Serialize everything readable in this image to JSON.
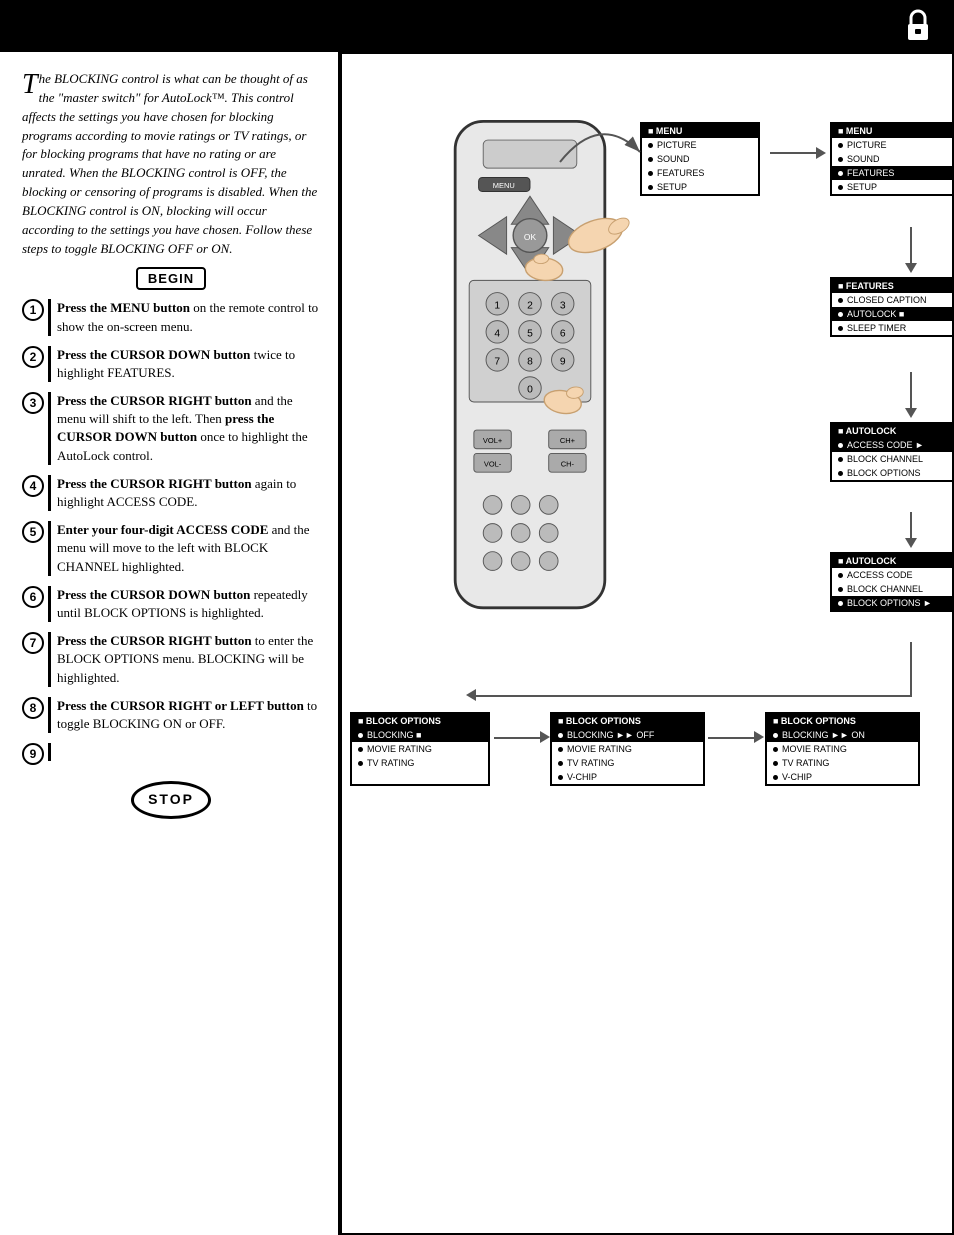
{
  "topBar": {
    "background": "#000"
  },
  "lockIcon": "🔒",
  "intro": {
    "dropCap": "T",
    "text": "he BLOCKING control is what can be thought of as the \"master switch\" for AutoLock™. This control affects the settings you have chosen for blocking programs according to movie ratings or TV ratings, or for blocking programs that have no rating or are unrated. When the BLOCKING control is OFF, the blocking or censoring of programs is disabled. When the BLOCKING control is ON, blocking will occur according to the settings you have chosen. Follow these steps to toggle BLOCKING OFF or ON."
  },
  "begin": "BEGIN",
  "steps": [
    {
      "num": "1",
      "text": "Press the MENU button on the remote control to show the on-screen menu."
    },
    {
      "num": "2",
      "text": "Press the CURSOR DOWN button twice to highlight FEATURES."
    },
    {
      "num": "3",
      "text": "Press the CURSOR RIGHT button and the menu will shift to the left. Then press the CURSOR DOWN button once to highlight the AutoLock control."
    },
    {
      "num": "4",
      "text": "Press the CURSOR RIGHT button again to highlight ACCESS CODE."
    },
    {
      "num": "5",
      "text": "Enter your four-digit ACCESS CODE and the menu will move to the left with BLOCK CHANNEL highlighted."
    },
    {
      "num": "6",
      "text": "Press the CURSOR DOWN button repeatedly until BLOCK OPTIONS is highlighted."
    },
    {
      "num": "7",
      "text": "Press the CURSOR RIGHT button to enter the BLOCK OPTIONS menu. BLOCKING will be highlighted."
    },
    {
      "num": "8",
      "text": "Press the CURSOR RIGHT or LEFT button to toggle BLOCKING ON or OFF."
    },
    {
      "num": "9",
      "text": ""
    }
  ],
  "stop": "STOP",
  "screens": {
    "screen1": {
      "title": "MENU",
      "items": [
        "PICTURE",
        "SOUND",
        "FEATURES",
        "SETUP"
      ]
    },
    "screen2": {
      "title": "MENU",
      "items": [
        "PICTURE",
        "SOUND",
        "FEATURES",
        "SETUP"
      ],
      "highlighted": "FEATURES"
    },
    "screen3": {
      "title": "FEATURES",
      "items": [
        "CLOSED CAPTION",
        "AUTOLOCK",
        "SLEEP TIMER"
      ],
      "highlighted": "AUTOLOCK"
    },
    "screen4": {
      "title": "AUTOLOCK",
      "items": [
        "ACCESS CODE",
        "BLOCK CHANNEL",
        "BLOCK OPTIONS"
      ],
      "highlighted": "ACCESS CODE"
    },
    "screen5": {
      "title": "AUTOLOCK",
      "items": [
        "ACCESS CODE",
        "BLOCK CHANNEL",
        "BLOCK OPTIONS"
      ],
      "highlighted": "BLOCK OPTIONS"
    },
    "screen6": {
      "title": "BLOCK OPTIONS",
      "items": [
        "BLOCKING",
        "MOVIE RATING",
        "TV RATING"
      ],
      "highlighted": "BLOCKING"
    },
    "screen7": {
      "title": "BLOCK OPTIONS",
      "items": [
        "BLOCKING  OFF",
        "MOVIE RATING",
        "TV RATING"
      ],
      "highlighted": "BLOCKING  OFF"
    },
    "screen8": {
      "title": "BLOCK OPTIONS",
      "items": [
        "BLOCKING  ON",
        "MOVIE RATING",
        "TV RATING"
      ],
      "highlighted": "BLOCKING  ON"
    }
  }
}
